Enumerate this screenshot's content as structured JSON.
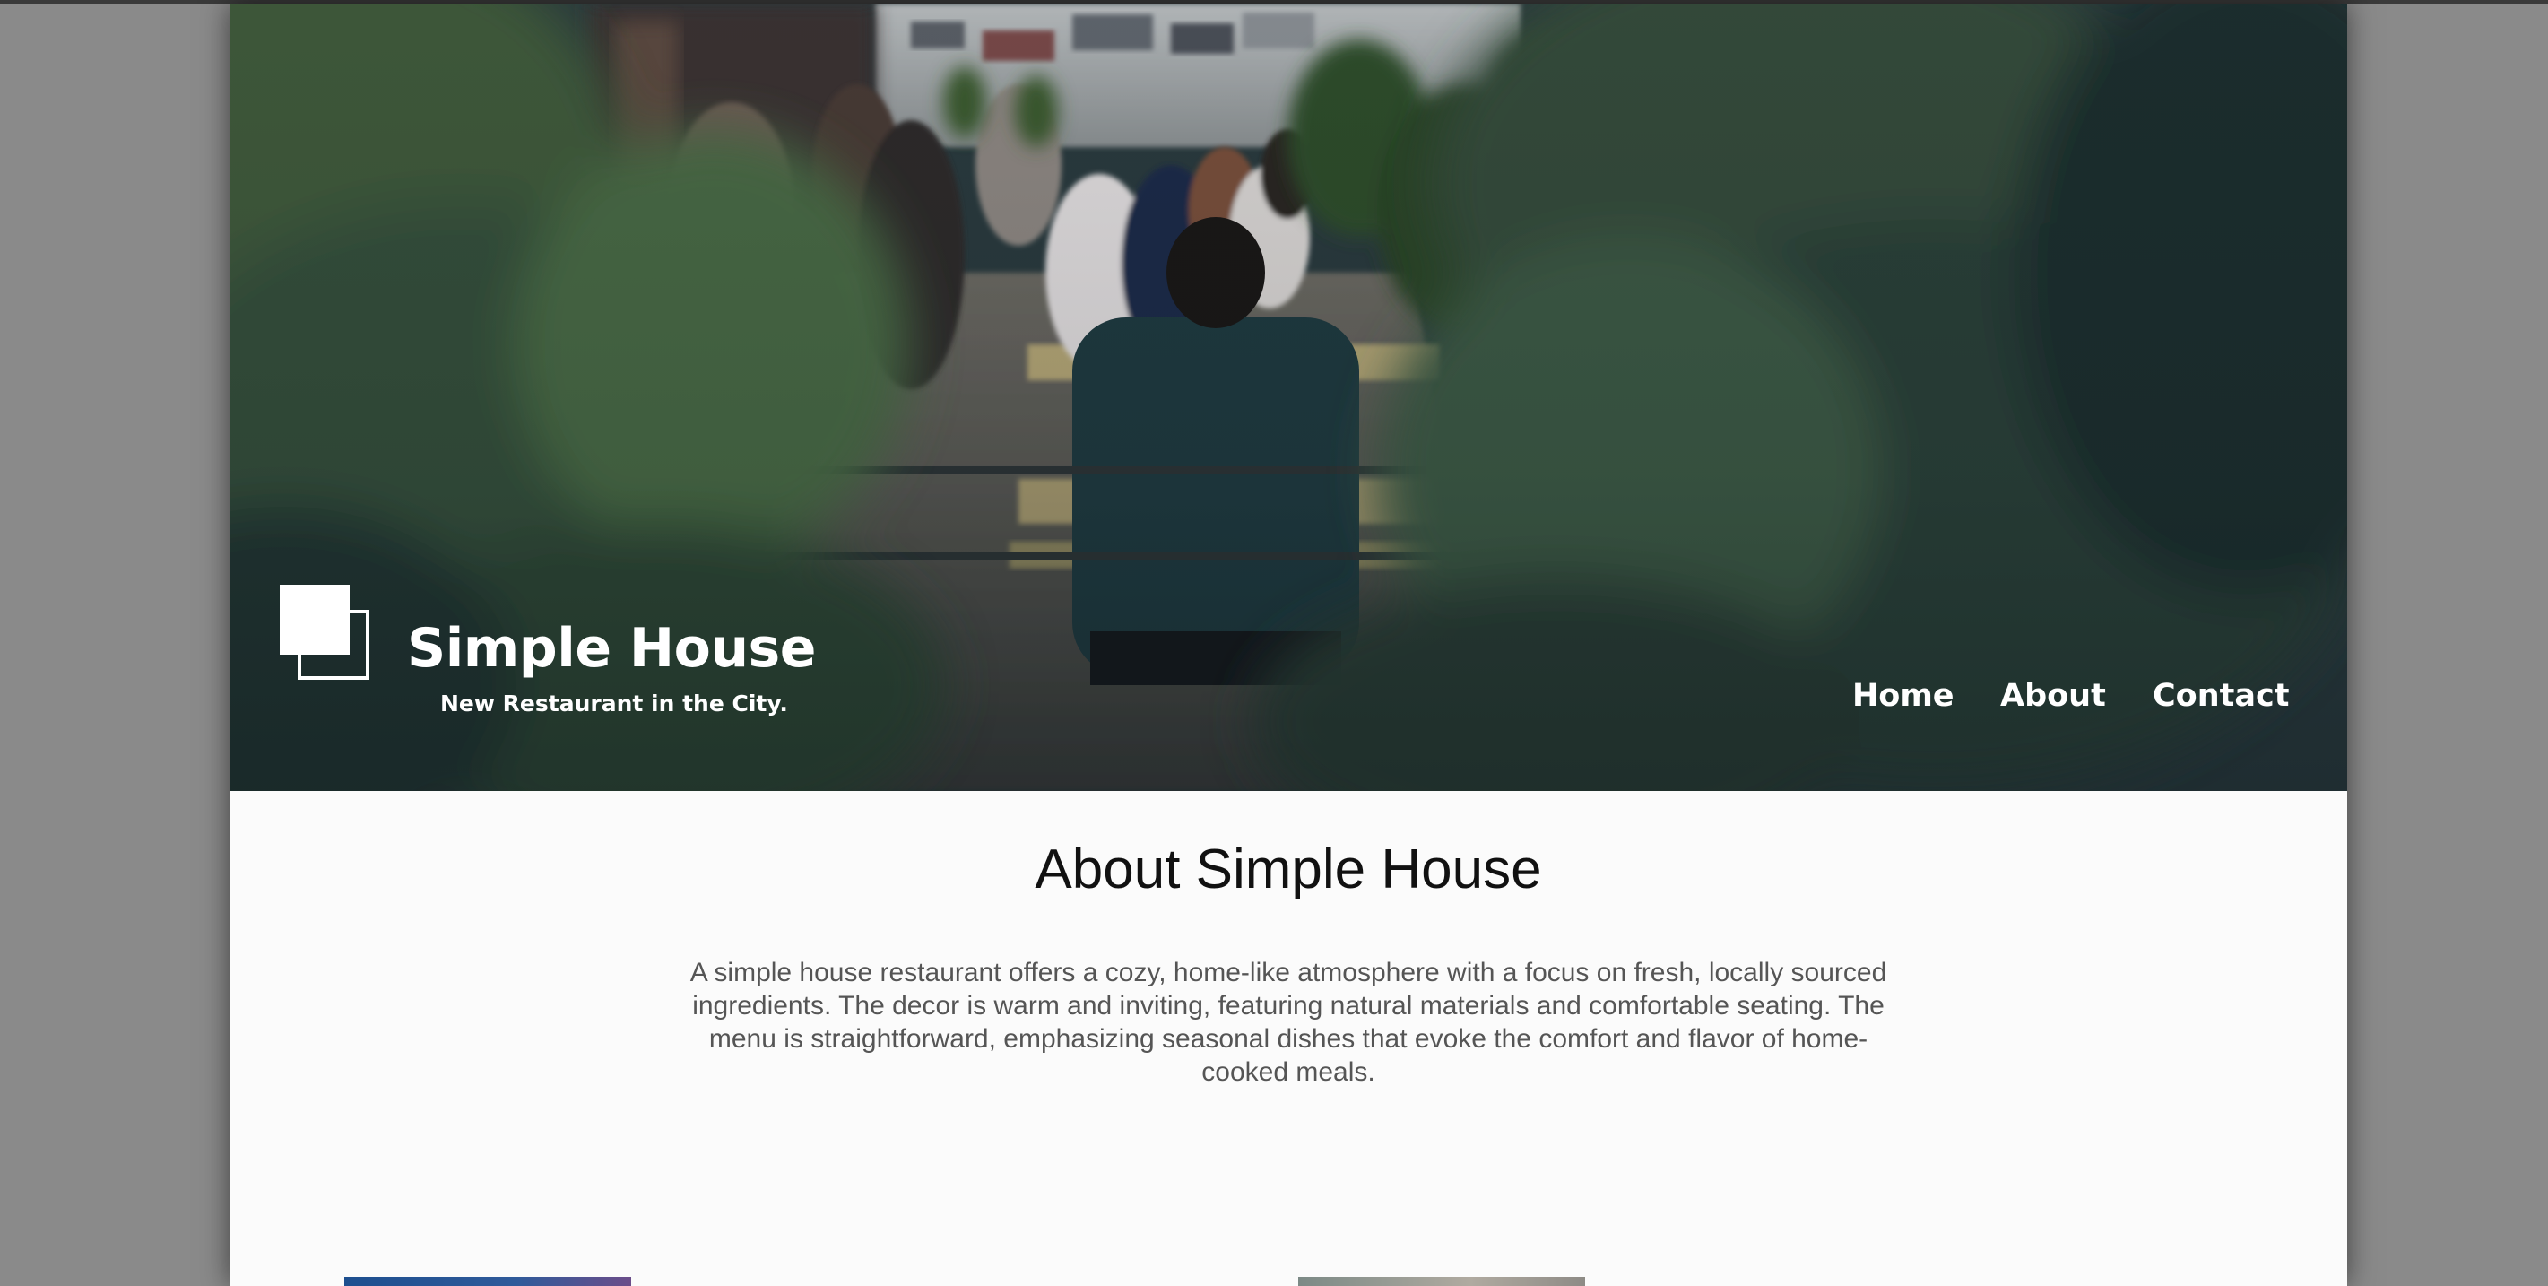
{
  "brand": {
    "title": "Simple House",
    "tagline": "New Restaurant in the City."
  },
  "nav": {
    "items": [
      {
        "label": "Home"
      },
      {
        "label": "About"
      },
      {
        "label": "Contact"
      }
    ]
  },
  "hero": {
    "image_description_icon": "restaurant-patio-photo"
  },
  "about": {
    "title": "About Simple House",
    "text": "A simple house restaurant offers a cozy, home-like atmosphere with a focus on fresh, locally sourced ingredients. The decor is warm and inviting, featuring natural materials and comfortable seating. The menu is straightforward, emphasizing seasonal dishes that evoke the comfort and flavor of home-cooked meals."
  },
  "colors": {
    "page_background": "#fbfbfb",
    "outer_background": "#8a8a8a",
    "hero_text": "#ffffff",
    "body_text": "#555555",
    "heading_text": "#111111"
  }
}
